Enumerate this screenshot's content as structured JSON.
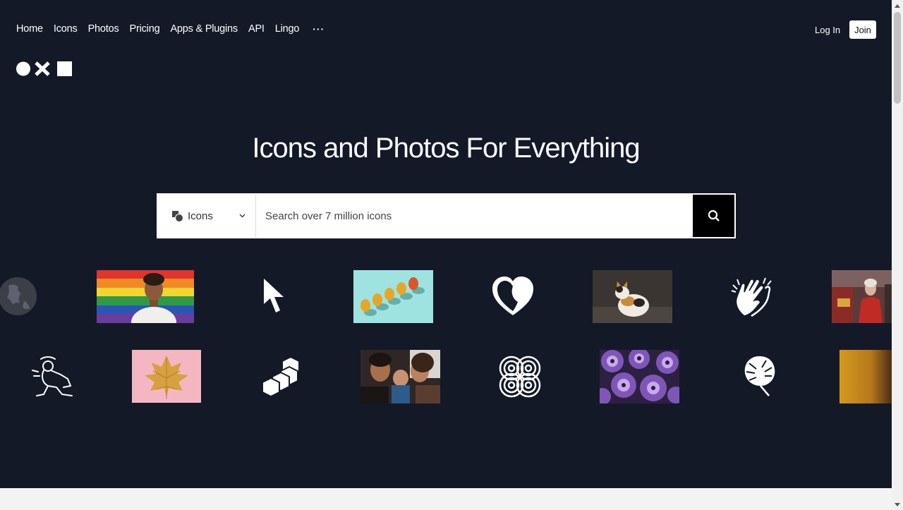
{
  "nav": {
    "items": [
      {
        "label": "Home"
      },
      {
        "label": "Icons"
      },
      {
        "label": "Photos"
      },
      {
        "label": "Pricing"
      },
      {
        "label": "Apps & Plugins"
      },
      {
        "label": "API"
      },
      {
        "label": "Lingo"
      }
    ],
    "more": "···",
    "login": "Log In",
    "join": "Join"
  },
  "hero": {
    "title": "Icons and Photos For Everything"
  },
  "search": {
    "category": "Icons",
    "placeholder": "Search over 7 million icons"
  },
  "gallery": {
    "row1": [
      "globe-icon",
      "pride-portrait-photo",
      "cursor-icon",
      "pears-photo",
      "heart-face-icon",
      "calico-cat-photo",
      "clapping-hands-icon",
      "street-portrait-photo"
    ],
    "row2": [
      "breakdancer-icon",
      "golden-leaf-photo",
      "blocks-icon",
      "family-photo",
      "knot-pattern-icon",
      "purple-petunias-photo",
      "monstera-leaf-icon",
      "orange-gradient-photo"
    ]
  },
  "colors": {
    "background": "#141928",
    "accent": "#000000",
    "text": "#ffffff"
  }
}
